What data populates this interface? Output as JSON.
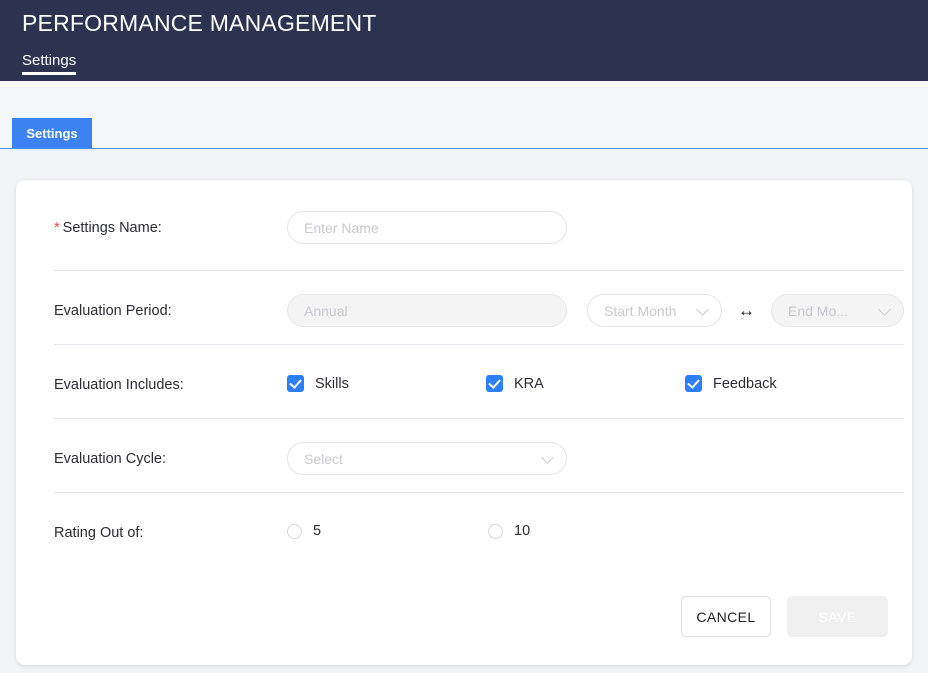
{
  "header": {
    "title": "PERFORMANCE MANAGEMENT",
    "nav": [
      {
        "label": "Settings",
        "active": true
      }
    ]
  },
  "tabs": [
    {
      "label": "Settings",
      "active": true
    }
  ],
  "form": {
    "settings_name": {
      "label": "Settings Name:",
      "required_marker": "*",
      "value": "",
      "placeholder": "Enter Name"
    },
    "evaluation_period": {
      "label": "Evaluation Period:",
      "period_value": "Annual",
      "period_disabled": true,
      "start_month": "Start Month",
      "end_month": "End Mo...",
      "end_month_disabled": true,
      "range_separator": "↔"
    },
    "evaluation_includes": {
      "label": "Evaluation Includes:",
      "options": [
        {
          "label": "Skills",
          "checked": true
        },
        {
          "label": "KRA",
          "checked": true
        },
        {
          "label": "Feedback",
          "checked": true
        }
      ]
    },
    "evaluation_cycle": {
      "label": "Evaluation Cycle:",
      "placeholder": "Select",
      "value": ""
    },
    "rating_out_of": {
      "label": "Rating Out of:",
      "options": [
        {
          "label": "5",
          "selected": false
        },
        {
          "label": "10",
          "selected": false
        }
      ]
    }
  },
  "actions": {
    "cancel_label": "CANCEL",
    "save_label": "SAVE",
    "save_disabled": true
  },
  "colors": {
    "header_bg": "#2b3350",
    "tab_active": "#3d82f2",
    "tab_underline": "#4a8ef0",
    "accent_checkbox": "#2d7ff9",
    "required_star": "#e8485b",
    "page_bg": "#f2f3f5"
  }
}
